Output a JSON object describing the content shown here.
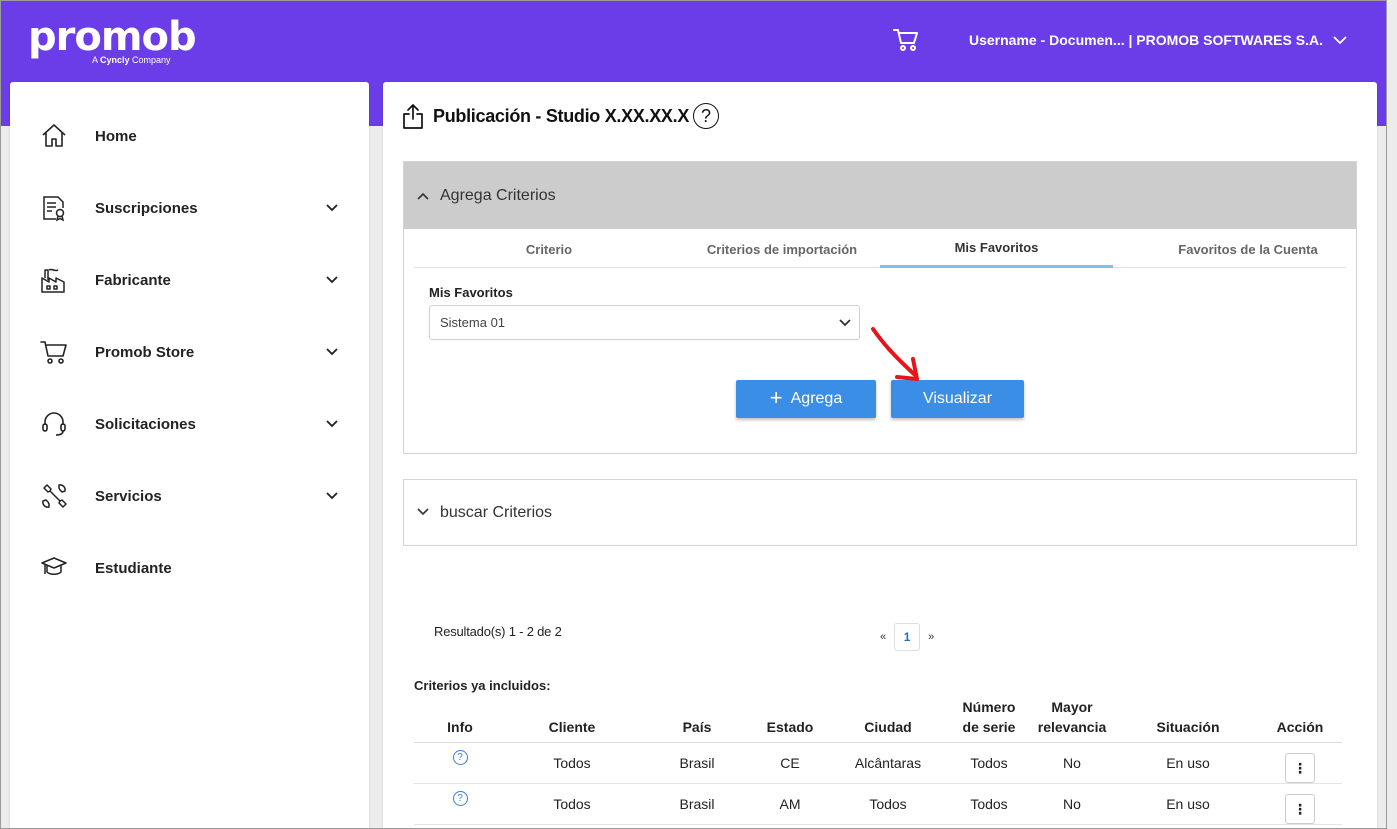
{
  "brand": {
    "logo_text": "promob",
    "tagline_prefix": "A ",
    "tagline_brand": "Cyncly",
    "tagline_suffix": " Company",
    "accent_color": "#6a3de8"
  },
  "header": {
    "cart_icon": "cart-icon",
    "user_label": "Username - Documen... | PROMOB SOFTWARES S.A."
  },
  "sidebar": {
    "items": [
      {
        "label": "Home",
        "icon": "home-icon",
        "has_children": false
      },
      {
        "label": "Suscripciones",
        "icon": "certificate-document-icon",
        "has_children": true
      },
      {
        "label": "Fabricante",
        "icon": "factory-icon",
        "has_children": true
      },
      {
        "label": "Promob Store",
        "icon": "cart-icon",
        "has_children": true
      },
      {
        "label": "Solicitaciones",
        "icon": "headset-icon",
        "has_children": true
      },
      {
        "label": "Servicios",
        "icon": "tools-icon",
        "has_children": true
      },
      {
        "label": "Estudiante",
        "icon": "graduation-cap-icon",
        "has_children": false
      }
    ]
  },
  "page": {
    "title": "Publicación - Studio X.XX.XX.X",
    "help": "?"
  },
  "criteria_panel": {
    "title": "Agrega Criterios",
    "tabs": [
      {
        "label": "Criterio",
        "active": false
      },
      {
        "label": "Criterios de importación",
        "active": false
      },
      {
        "label": "Mis Favoritos",
        "active": true
      },
      {
        "label": "Favoritos de la Cuenta",
        "active": false
      }
    ],
    "favorites_label": "Mis Favoritos",
    "favorites_selected": "Sistema 01",
    "add_button": "Agrega",
    "add_button_prefix": "+",
    "view_button": "Visualizar",
    "button_color": "#3b8ee6"
  },
  "search_panel": {
    "title": "buscar Criterios"
  },
  "results": {
    "summary": "Resultado(s) 1 - 2 de 2",
    "prev": "«",
    "current_page": "1",
    "next": "»"
  },
  "included": {
    "title": "Criterios ya incluidos:",
    "columns": {
      "info": "Info",
      "cliente": "Cliente",
      "pais": "País",
      "estado": "Estado",
      "ciudad": "Ciudad",
      "serie_1": "Número",
      "serie_2": "de serie",
      "relevancia_1": "Mayor",
      "relevancia_2": "relevancia",
      "situacion": "Situación",
      "accion": "Acción"
    },
    "rows": [
      {
        "info": "?",
        "cliente": "Todos",
        "pais": "Brasil",
        "estado": "CE",
        "ciudad": "Alcântaras",
        "serie": "Todos",
        "relevancia": "No",
        "situacion": "En uso",
        "accion": "⋮"
      },
      {
        "info": "?",
        "cliente": "Todos",
        "pais": "Brasil",
        "estado": "AM",
        "ciudad": "Todos",
        "serie": "Todos",
        "relevancia": "No",
        "situacion": "En uso",
        "accion": "⋮"
      }
    ]
  }
}
